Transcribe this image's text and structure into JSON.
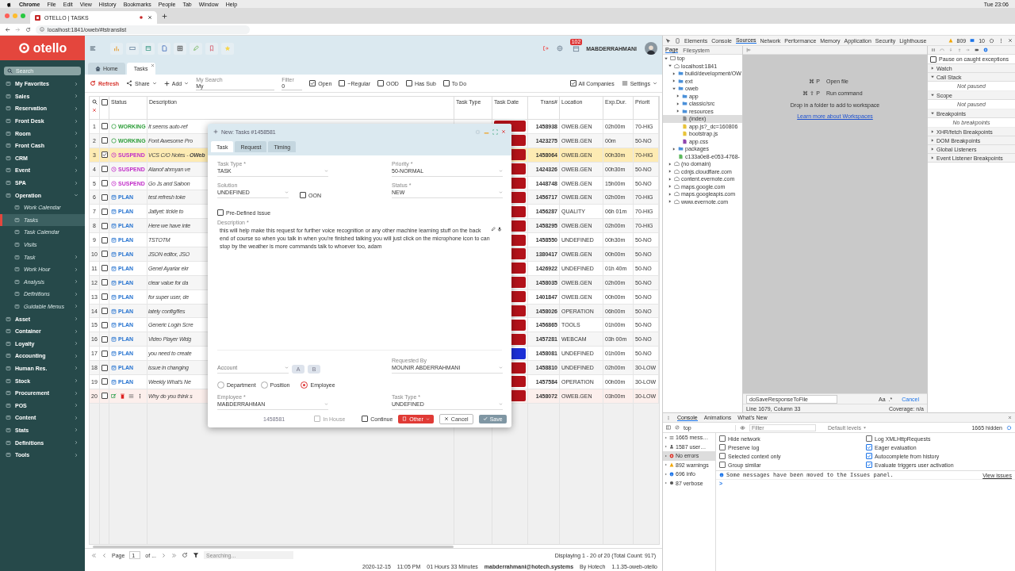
{
  "os_menu": {
    "app": "Chrome",
    "items": [
      "File",
      "Edit",
      "View",
      "History",
      "Bookmarks",
      "People",
      "Tab",
      "Window",
      "Help"
    ],
    "clock": "Tue 23:06"
  },
  "browser": {
    "tab_title": "OTELLO | TASKS",
    "url": "localhost:1841/oweb/#tstranslist"
  },
  "sidebar": {
    "logo": "otello",
    "search_placeholder": "Search",
    "items": [
      {
        "label": "My Favorites",
        "expanded": false,
        "selected": false
      },
      {
        "label": "Sales",
        "expanded": false,
        "selected": false
      },
      {
        "label": "Reservation",
        "expanded": false,
        "selected": false
      },
      {
        "label": "Front Desk",
        "expanded": false,
        "selected": false
      },
      {
        "label": "Room",
        "expanded": false,
        "selected": false
      },
      {
        "label": "Front Cash",
        "expanded": false,
        "selected": false
      },
      {
        "label": "CRM",
        "expanded": false,
        "selected": false
      },
      {
        "label": "Event",
        "expanded": false,
        "selected": false
      },
      {
        "label": "SPA",
        "expanded": false,
        "selected": false
      },
      {
        "label": "Operation",
        "expanded": true,
        "selected": false,
        "children": [
          {
            "label": "Work Calendar",
            "selected": false
          },
          {
            "label": "Tasks",
            "selected": true
          },
          {
            "label": "Task Calendar",
            "selected": false
          },
          {
            "label": "Visits",
            "selected": false
          },
          {
            "label": "Task",
            "expanded": false,
            "selected": false
          },
          {
            "label": "Work Hour",
            "expanded": false,
            "selected": false
          },
          {
            "label": "Analysis",
            "expanded": false,
            "selected": false
          },
          {
            "label": "Definitions",
            "expanded": false,
            "selected": false
          },
          {
            "label": "Guidable Menus",
            "expanded": false,
            "selected": false
          }
        ]
      },
      {
        "label": "Asset",
        "expanded": false,
        "selected": false
      },
      {
        "label": "Container",
        "expanded": false,
        "selected": false
      },
      {
        "label": "Loyalty",
        "expanded": false,
        "selected": false
      },
      {
        "label": "Accounting",
        "expanded": false,
        "selected": false
      },
      {
        "label": "Human Res.",
        "expanded": false,
        "selected": false
      },
      {
        "label": "Stock",
        "expanded": false,
        "selected": false
      },
      {
        "label": "Procurement",
        "expanded": false,
        "selected": false
      },
      {
        "label": "POS",
        "expanded": false,
        "selected": false
      },
      {
        "label": "Content",
        "expanded": false,
        "selected": false
      },
      {
        "label": "Stats",
        "expanded": false,
        "selected": false
      },
      {
        "label": "Definitions",
        "expanded": false,
        "selected": false
      },
      {
        "label": "Tools",
        "expanded": false,
        "selected": false
      }
    ]
  },
  "header": {
    "notification_count": "102",
    "user": "MABDERRAHMANI"
  },
  "tabs": [
    {
      "label": "Home",
      "selected": false
    },
    {
      "label": "Tasks",
      "selected": true
    }
  ],
  "toolbar": {
    "refresh": "Refresh",
    "share": "Share",
    "add": "Add",
    "my_search": {
      "label": "My Search",
      "value": "My"
    },
    "filter": {
      "label": "Filter",
      "value": "0"
    },
    "checks": [
      {
        "label": "Open",
        "checked": true
      },
      {
        "label": "~Regular",
        "checked": false
      },
      {
        "label": "OOD",
        "checked": false
      },
      {
        "label": "Has Sub",
        "checked": false
      },
      {
        "label": "To Do",
        "checked": false
      }
    ],
    "all_companies": {
      "label": "All Companies",
      "checked": true
    },
    "settings": "Settings"
  },
  "table": {
    "select_all": {
      "checked": false
    },
    "columns": [
      "Status",
      "Description",
      "Task Type",
      "Task Date",
      "Trans#",
      "Location",
      "Exp.Dur.",
      "Priorit"
    ],
    "rows": [
      {
        "n": "1",
        "selected": false,
        "hovered": false,
        "status": {
          "kind": "working",
          "label": "WORKING"
        },
        "description": "It seems auto-ref",
        "color": "#b3121a",
        "trans": "1458938",
        "location": "OWEB.GEN",
        "duration": "02h00m",
        "priority": "70-HIG"
      },
      {
        "n": "2",
        "selected": false,
        "hovered": false,
        "status": {
          "kind": "working",
          "label": "WORKING"
        },
        "description": "Font Awesome Pro",
        "color": "#b3121a",
        "trans": "1423275",
        "location": "OWEB.GEN",
        "duration": "00m",
        "priority": "50-NO"
      },
      {
        "n": "3",
        "selected": true,
        "hovered": false,
        "status": {
          "kind": "suspend",
          "label": "SUSPEND"
        },
        "description": "VCS C/O Notes - **OWeb**",
        "color": "#b3121a",
        "trans": "1458064",
        "location": "OWEB.GEN",
        "duration": "00h30m",
        "priority": "70-HIG"
      },
      {
        "n": "4",
        "selected": false,
        "hovered": false,
        "status": {
          "kind": "suspend",
          "label": "SUSPEND"
        },
        "description": "Alanof ahmyan ve",
        "color": "#b3121a",
        "trans": "1424326",
        "location": "OWEB.GEN",
        "duration": "00h30m",
        "priority": "50-NO"
      },
      {
        "n": "5",
        "selected": false,
        "hovered": false,
        "status": {
          "kind": "suspend",
          "label": "SUSPEND"
        },
        "description": "Go Js and Saloon",
        "color": "#b3121a",
        "trans": "1448748",
        "location": "OWEB.GEN",
        "duration": "15h00m",
        "priority": "50-NO"
      },
      {
        "n": "6",
        "selected": false,
        "hovered": false,
        "status": {
          "kind": "plan",
          "label": "PLAN"
        },
        "description": "test refresh toke",
        "color": "#b3121a",
        "trans": "1456717",
        "location": "OWEB.GEN",
        "duration": "02h00m",
        "priority": "70-HIG"
      },
      {
        "n": "7",
        "selected": false,
        "hovered": false,
        "status": {
          "kind": "plan",
          "label": "PLAN"
        },
        "description": "Jatlyet: tickle to",
        "color": "#b3121a",
        "trans": "1456287",
        "location": "QUALITY",
        "duration": "06h 01m",
        "priority": "70-HIG"
      },
      {
        "n": "8",
        "selected": false,
        "hovered": false,
        "status": {
          "kind": "plan",
          "label": "PLAN"
        },
        "description": "Here we have inte",
        "color": "#b3121a",
        "trans": "1458295",
        "location": "OWEB.GEN",
        "duration": "02h00m",
        "priority": "70-HIG"
      },
      {
        "n": "9",
        "selected": false,
        "hovered": false,
        "status": {
          "kind": "plan",
          "label": "PLAN"
        },
        "description": "TSTOTM",
        "color": "#b3121a",
        "trans": "1458550",
        "location": "UNDEFINED",
        "duration": "00h30m",
        "priority": "50-NO"
      },
      {
        "n": "10",
        "selected": false,
        "hovered": false,
        "status": {
          "kind": "plan",
          "label": "PLAN"
        },
        "description": "JSON editor, JSO",
        "color": "#b3121a",
        "trans": "1380417",
        "location": "OWEB.GEN",
        "duration": "00h00m",
        "priority": "50-NO"
      },
      {
        "n": "11",
        "selected": false,
        "hovered": false,
        "status": {
          "kind": "plan",
          "label": "PLAN"
        },
        "description": "Genel Ayarlar ekr",
        "color": "#b3121a",
        "trans": "1426922",
        "location": "UNDEFINED",
        "duration": "01h 40m",
        "priority": "50-NO"
      },
      {
        "n": "12",
        "selected": false,
        "hovered": false,
        "status": {
          "kind": "plan",
          "label": "PLAN"
        },
        "description": "clear value for da",
        "color": "#b3121a",
        "trans": "1458035",
        "location": "OWEB.GEN",
        "duration": "02h00m",
        "priority": "50-NO"
      },
      {
        "n": "13",
        "selected": false,
        "hovered": false,
        "status": {
          "kind": "plan",
          "label": "PLAN"
        },
        "description": "for super user, de",
        "color": "#b3121a",
        "trans": "1401847",
        "location": "OWEB.GEN",
        "duration": "00h00m",
        "priority": "50-NO"
      },
      {
        "n": "14",
        "selected": false,
        "hovered": false,
        "status": {
          "kind": "plan",
          "label": "PLAN"
        },
        "description": "lately config/fles",
        "color": "#b3121a",
        "trans": "1458026",
        "location": "OPERATION",
        "duration": "06h00m",
        "priority": "50-NO"
      },
      {
        "n": "15",
        "selected": false,
        "hovered": false,
        "status": {
          "kind": "plan",
          "label": "PLAN"
        },
        "description": "Generic Login Scre",
        "color": "#b3121a",
        "trans": "1456865",
        "location": "TOOLS",
        "duration": "01h00m",
        "priority": "50-NO"
      },
      {
        "n": "16",
        "selected": false,
        "hovered": false,
        "status": {
          "kind": "plan",
          "label": "PLAN"
        },
        "description": "Video Player Widg",
        "color": "#b3121a",
        "trans": "1457281",
        "location": "WEBCAM",
        "duration": "03h 00m",
        "priority": "50-NO"
      },
      {
        "n": "17",
        "selected": false,
        "hovered": false,
        "status": {
          "kind": "plan",
          "label": "PLAN"
        },
        "description": "you need to create",
        "color": "#1c2fd6",
        "trans": "1458081",
        "location": "UNDEFINED",
        "duration": "01h00m",
        "priority": "50-NO"
      },
      {
        "n": "18",
        "selected": false,
        "hovered": false,
        "status": {
          "kind": "plan",
          "label": "PLAN"
        },
        "description": "issue in changing",
        "color": "#b3121a",
        "trans": "1458810",
        "location": "UNDEFINED",
        "duration": "02h00m",
        "priority": "30-LOW"
      },
      {
        "n": "19",
        "selected": false,
        "hovered": false,
        "status": {
          "kind": "plan",
          "label": "PLAN"
        },
        "description": "Weekly What's Ne",
        "color": "#b3121a",
        "trans": "1457584",
        "location": "OPERATION",
        "duration": "00h00m",
        "priority": "30-LOW"
      },
      {
        "n": "20",
        "selected": false,
        "hovered": true,
        "description": "Why do you think s",
        "color": "#b3121a",
        "trans": "1458072",
        "location": "OWEB.GEN",
        "duration": "03h00m",
        "priority": "30-LOW"
      }
    ]
  },
  "dialog": {
    "title": "New: Tasks #1458581",
    "tabs": [
      {
        "label": "Task",
        "selected": true
      },
      {
        "label": "Request",
        "selected": false
      },
      {
        "label": "Timing",
        "selected": false
      }
    ],
    "fields": [
      {
        "label": "Task Type *",
        "value": "TASK"
      },
      {
        "label": "Priority *",
        "value": "50-NORMAL"
      },
      {
        "label": "Solution",
        "value": "UNDEFINED"
      },
      {
        "label": "Status *",
        "value": "NEW"
      }
    ],
    "oon": {
      "label": "OON",
      "checked": false
    },
    "predefined_issue": {
      "label": "Pre-Defined Issue",
      "checked": false
    },
    "description": {
      "label": "Description *",
      "value": "this will help make this request for further voice recognition or any other machine learning stuff on the back end of course so when you talk in when you're finished talking you will just click on the microphone icon to can stop by the weather is more commands talk to whoever too, adam"
    },
    "account": {
      "placeholder": "Account",
      "buttons": [
        "A",
        "B"
      ]
    },
    "requested_by": {
      "label": "Requested By",
      "value": "MOUNIR ABDERRAHMANI"
    },
    "assign_to": [
      {
        "label": "Department",
        "selected": false
      },
      {
        "label": "Position",
        "selected": false
      },
      {
        "label": "Employee",
        "selected": true
      }
    ],
    "employee": {
      "label": "Employee *",
      "value": "MABDERRAHMAN"
    },
    "task_type": {
      "label": "Task Type *",
      "value": "UNDEFINED"
    },
    "footer": {
      "id": "1458581",
      "in_house": {
        "label": "In House",
        "checked": false,
        "disabled": true
      },
      "continue": {
        "label": "Continue",
        "checked": false
      },
      "buttons": [
        {
          "label": "Other",
          "kind": "other",
          "disabled": false
        },
        {
          "label": "Cancel",
          "kind": "cancel",
          "disabled": false
        },
        {
          "label": "Save",
          "kind": "save",
          "disabled": true
        }
      ]
    }
  },
  "pager": {
    "page_label": "Page",
    "page": "1",
    "of": "of ...",
    "search_placeholder": "Searching...",
    "display": "Displaying 1 - 20 of 20 (Total Count: 917)"
  },
  "status_bar": [
    "2020-12-15",
    "11:05 PM",
    "01 Hours 33 Minutes",
    "mabderrahmani@hotech.systems",
    "By Hotech",
    "1.1.35-oweb-otello"
  ],
  "devtools": {
    "tabs": [
      {
        "label": "Elements",
        "selected": false
      },
      {
        "label": "Console",
        "selected": false
      },
      {
        "label": "Sources",
        "selected": true
      },
      {
        "label": "Network",
        "selected": false
      },
      {
        "label": "Performance",
        "selected": false
      },
      {
        "label": "Memory",
        "selected": false
      },
      {
        "label": "Application",
        "selected": false
      },
      {
        "label": "Security",
        "selected": false
      },
      {
        "label": "Lighthouse",
        "selected": false
      }
    ],
    "warnings": "809",
    "messages": "10",
    "navigator_tabs": [
      {
        "label": "Page",
        "selected": true
      },
      {
        "label": "Filesystem",
        "selected": false
      }
    ],
    "tree": [
      {
        "label": "top",
        "kind": "frame",
        "expanded": true,
        "selected": false,
        "children": [
          {
            "label": "localhost:1841",
            "kind": "domain",
            "expanded": true,
            "selected": false,
            "children": [
              {
                "label": "build/development/OW",
                "kind": "folder",
                "expanded": false,
                "selected": false
              },
              {
                "label": "ext",
                "kind": "folder",
                "expanded": false,
                "selected": false
              },
              {
                "label": "oweb",
                "kind": "folder",
                "expanded": true,
                "selected": false,
                "children": [
                  {
                    "label": "app",
                    "kind": "folder",
                    "expanded": false,
                    "selected": false
                  },
                  {
                    "label": "classic/src",
                    "kind": "folder",
                    "expanded": false,
                    "selected": false
                  },
                  {
                    "label": "resources",
                    "kind": "folder",
                    "expanded": false,
                    "selected": false
                  },
                  {
                    "label": "(index)",
                    "kind": "document",
                    "selected": true
                  },
                  {
                    "label": "app.js?_dc=160806",
                    "kind": "script",
                    "selected": false
                  },
                  {
                    "label": "bootstrap.js",
                    "kind": "script",
                    "selected": false
                  },
                  {
                    "label": "app.css",
                    "kind": "style",
                    "selected": false
                  }
                ]
              },
              {
                "label": "packages",
                "kind": "folder",
                "expanded": false,
                "selected": false
              },
              {
                "label": "c133a0e8-e053-4768-",
                "kind": "worker",
                "selected": false
              }
            ]
          },
          {
            "label": "(no domain)",
            "kind": "domain",
            "expanded": false,
            "selected": false
          },
          {
            "label": "cdnjs.cloudflare.com",
            "kind": "domain",
            "expanded": false,
            "selected": false
          },
          {
            "label": "content.evernote.com",
            "kind": "domain",
            "expanded": false,
            "selected": false
          },
          {
            "label": "maps.google.com",
            "kind": "domain",
            "expanded": false,
            "selected": false
          },
          {
            "label": "maps.googleapis.com",
            "kind": "domain",
            "expanded": false,
            "selected": false
          },
          {
            "label": "www.evernote.com",
            "kind": "domain",
            "expanded": false,
            "selected": false
          }
        ]
      }
    ],
    "shortcuts": [
      {
        "keys": "⌘ P",
        "label": "Open file"
      },
      {
        "keys": "⌘ ⇧ P",
        "label": "Run command"
      }
    ],
    "drop_hint": "Drop in a folder to add to workspace",
    "learn_link": "Learn more about Workspaces",
    "search": {
      "query": "doSaveResponseToFile",
      "case": "Aa",
      "regex": ".*",
      "cancel": "Cancel",
      "position": "Line 1679, Column 33",
      "coverage": "Coverage: n/a"
    },
    "pause_caught": {
      "label": "Pause on caught exceptions",
      "checked": false
    },
    "sections": [
      {
        "label": "Watch",
        "expanded": false
      },
      {
        "label": "Call Stack",
        "expanded": true,
        "note": "Not paused"
      },
      {
        "label": "Scope",
        "expanded": true,
        "note": "Not paused"
      },
      {
        "label": "Breakpoints",
        "expanded": true,
        "note": "No breakpoints"
      },
      {
        "label": "XHR/fetch Breakpoints",
        "expanded": false
      },
      {
        "label": "DOM Breakpoints",
        "expanded": false
      },
      {
        "label": "Global Listeners",
        "expanded": false
      },
      {
        "label": "Event Listener Breakpoints",
        "expanded": false
      }
    ],
    "drawer_tabs": [
      {
        "label": "Console",
        "selected": true
      },
      {
        "label": "Animations",
        "selected": false
      },
      {
        "label": "What's New",
        "selected": false
      }
    ],
    "context": "top",
    "filter_placeholder": "Filter",
    "levels": "Default levels",
    "hidden": "1665 hidden",
    "groups": [
      {
        "label": "1665 mess…",
        "kind": "messages",
        "selected": false
      },
      {
        "label": "1587 user…",
        "kind": "user",
        "selected": false
      },
      {
        "label": "No errors",
        "kind": "errors",
        "selected": true
      },
      {
        "label": "892 warnings",
        "kind": "warnings",
        "selected": false
      },
      {
        "label": "696 info",
        "kind": "info",
        "selected": false
      },
      {
        "label": "87 verbose",
        "kind": "verbose",
        "selected": false
      }
    ],
    "settings": [
      {
        "label": "Hide network",
        "checked": false
      },
      {
        "label": "Log XMLHttpRequests",
        "checked": false
      },
      {
        "label": "Preserve log",
        "checked": false
      },
      {
        "label": "Eager evaluation",
        "checked": true
      },
      {
        "label": "Selected context only",
        "checked": false
      },
      {
        "label": "Autocomplete from history",
        "checked": true
      },
      {
        "label": "Group similar",
        "checked": false
      },
      {
        "label": "Evaluate triggers user activation",
        "checked": true
      }
    ],
    "issue_message": "Some messages have been moved to the Issues panel.",
    "issue_link": "View issues",
    "prompt": ">"
  }
}
